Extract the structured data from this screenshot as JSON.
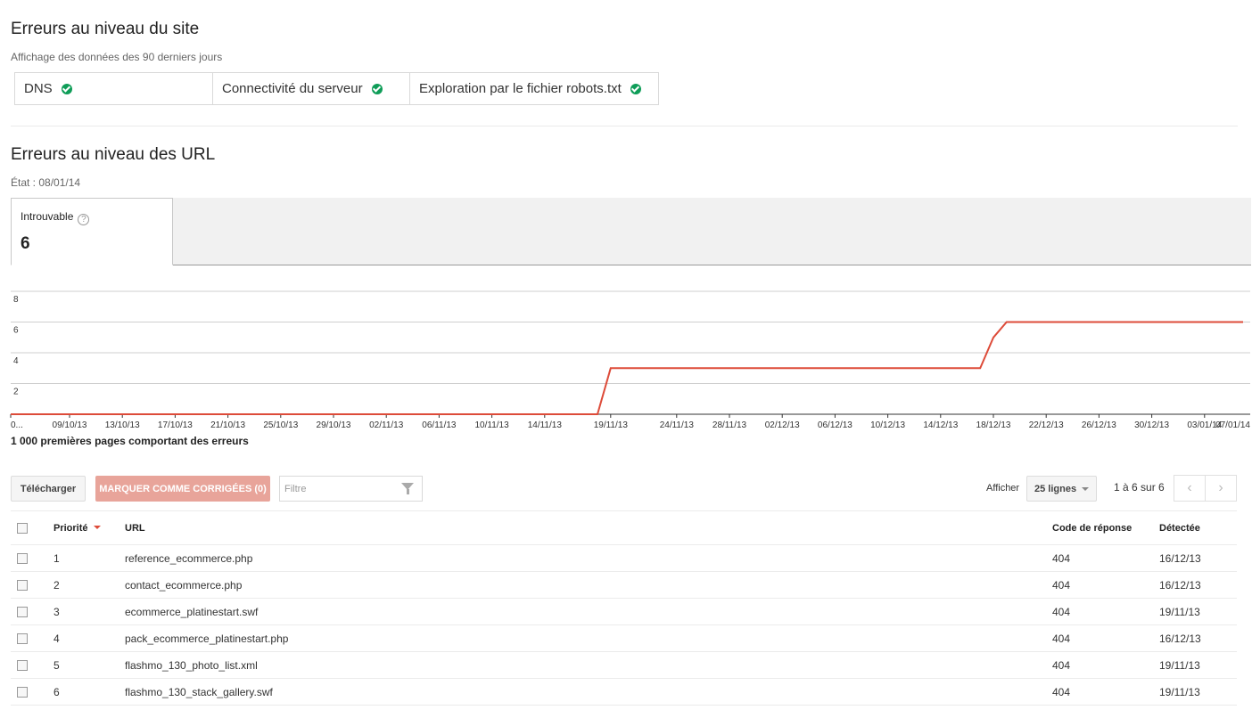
{
  "site_errors": {
    "title": "Erreurs au niveau du site",
    "subtitle": "Affichage des données des 90 derniers jours",
    "checks": [
      {
        "label": "DNS",
        "status_icon": "check-circle-icon",
        "status_color": "#0f9d58"
      },
      {
        "label": "Connectivité du serveur",
        "status_icon": "check-circle-icon",
        "status_color": "#0f9d58"
      },
      {
        "label": "Exploration par le fichier robots.txt",
        "status_icon": "check-circle-icon",
        "status_color": "#0f9d58"
      }
    ]
  },
  "url_errors": {
    "title": "Erreurs au niveau des URL",
    "state": "État : 08/01/14",
    "tab": {
      "label": "Introuvable",
      "help": "?",
      "value": "6"
    },
    "caption": "1 000 premières pages comportant des erreurs"
  },
  "chart_data": {
    "type": "line",
    "y_ticks": [
      "8",
      "6",
      "4",
      "2"
    ],
    "ylim": [
      0,
      8
    ],
    "x_labels": [
      "0...",
      "09/10/13",
      "13/10/13",
      "17/10/13",
      "21/10/13",
      "25/10/13",
      "29/10/13",
      "02/11/13",
      "06/11/13",
      "10/11/13",
      "14/11/13",
      "19/11/13",
      "24/11/13",
      "28/11/13",
      "02/12/13",
      "06/12/13",
      "10/12/13",
      "14/12/13",
      "18/12/13",
      "22/12/13",
      "26/12/13",
      "30/12/13",
      "03/01/14",
      "07/01/14"
    ],
    "series": [
      {
        "color": "#dd4b39",
        "x": [
          "0...",
          "18/11/13",
          "19/11/13",
          "17/12/13",
          "18/12/13",
          "19/12/13",
          "08/01/14"
        ],
        "values": [
          0,
          0,
          3,
          3,
          5,
          6,
          6
        ]
      }
    ],
    "grid": true
  },
  "toolbar": {
    "download": "Télécharger",
    "mark_fixed": "MARQUER COMME CORRIGÉES (0)",
    "filter_placeholder": "Filtre",
    "show_label": "Afficher",
    "rows_select": "25 lignes",
    "pager_text": "1 à 6 sur 6",
    "prev": "‹",
    "next": "›"
  },
  "table": {
    "headers": {
      "priority": "Priorité",
      "url": "URL",
      "code": "Code de réponse",
      "detected": "Détectée"
    },
    "rows": [
      {
        "priority": "1",
        "url": "reference_ecommerce.php",
        "code": "404",
        "detected": "16/12/13"
      },
      {
        "priority": "2",
        "url": "contact_ecommerce.php",
        "code": "404",
        "detected": "16/12/13"
      },
      {
        "priority": "3",
        "url": "ecommerce_platinestart.swf",
        "code": "404",
        "detected": "19/11/13"
      },
      {
        "priority": "4",
        "url": "pack_ecommerce_platinestart.php",
        "code": "404",
        "detected": "16/12/13"
      },
      {
        "priority": "5",
        "url": "flashmo_130_photo_list.xml",
        "code": "404",
        "detected": "19/11/13"
      },
      {
        "priority": "6",
        "url": "flashmo_130_stack_gallery.swf",
        "code": "404",
        "detected": "19/11/13"
      }
    ]
  }
}
